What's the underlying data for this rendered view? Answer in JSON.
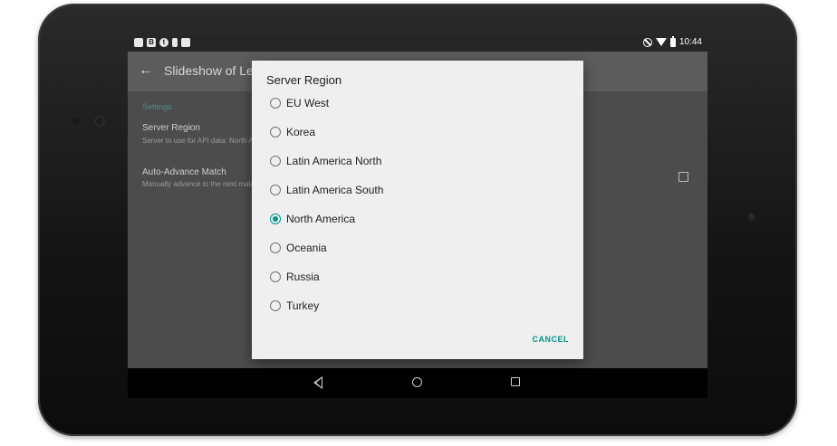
{
  "status_bar": {
    "time": "10:44",
    "left_icons": [
      "notification-icon",
      "blogger-icon",
      "tumblr-icon",
      "pin-icon",
      "photo-icon"
    ],
    "right_icons": [
      "do-not-disturb-icon",
      "wifi-icon",
      "battery-icon"
    ]
  },
  "app_bar": {
    "title": "Slideshow of Legends",
    "back_icon": "back-arrow-icon"
  },
  "settings": {
    "section_header": "Settings",
    "server_region": {
      "title": "Server Region",
      "summary": "Server to use for API data: North America"
    },
    "auto_advance": {
      "title": "Auto-Advance Match",
      "summary": "Manually advance to the next match",
      "checked": false
    }
  },
  "dialog": {
    "title": "Server Region",
    "options": [
      {
        "label": "EU West",
        "selected": false
      },
      {
        "label": "Korea",
        "selected": false
      },
      {
        "label": "Latin America North",
        "selected": false
      },
      {
        "label": "Latin America South",
        "selected": false
      },
      {
        "label": "North America",
        "selected": true
      },
      {
        "label": "Oceania",
        "selected": false
      },
      {
        "label": "Russia",
        "selected": false
      },
      {
        "label": "Turkey",
        "selected": false
      }
    ],
    "cancel_label": "CANCEL"
  },
  "nav_bar": {
    "icons": [
      "nav-back-icon",
      "nav-home-icon",
      "nav-recents-icon"
    ]
  },
  "colors": {
    "accent": "#009688",
    "dialog_bg": "#efefef",
    "scrim_screen": "#4a4a4a"
  }
}
